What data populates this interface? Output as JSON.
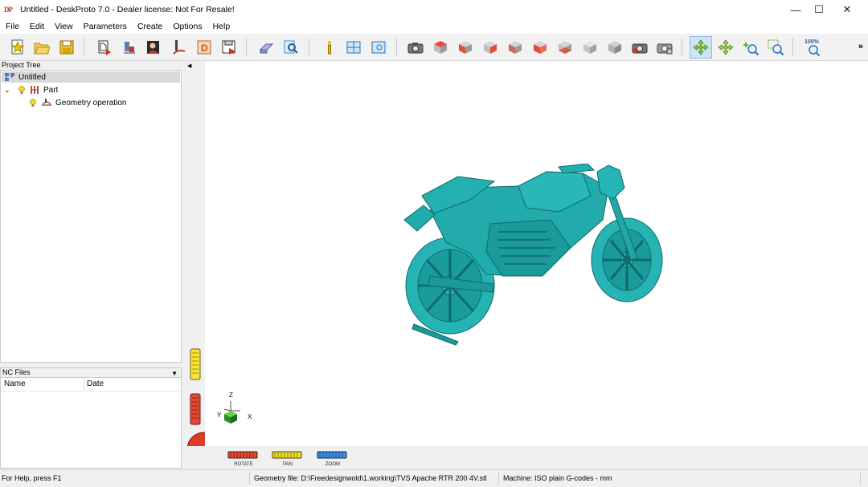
{
  "window": {
    "icon_text": "DP",
    "title": "Untitled - DeskProto 7.0 - Dealer license: Not For Resale!",
    "minimize": "—",
    "maximize": "☐",
    "close": "✕"
  },
  "menu": [
    "File",
    "Edit",
    "View",
    "Parameters",
    "Create",
    "Options",
    "Help"
  ],
  "toolbar": {
    "zoom_100_label": "100%",
    "more": "»"
  },
  "project_tree": {
    "header": "Project Tree",
    "root": "Untitled",
    "part": "Part",
    "geometry_operation": "Geometry operation"
  },
  "nc_files": {
    "header": "NC Files",
    "columns": [
      "Name",
      "Date"
    ]
  },
  "viewport": {
    "axis_z": "Z",
    "axis_y": "Y",
    "axis_x": "X",
    "model_color": "#1fa9a9"
  },
  "mouse_controls": {
    "rotate": "ROTATE",
    "pan": "PAN",
    "zoom": "ZOOM"
  },
  "status": {
    "help": "For Help, press F1",
    "geometry_file": "Geometry file: D:\\Freedesignwold\\1.working\\TVS Apache RTR 200 4V.stl",
    "machine": "Machine: ISO plain G-codes - mm"
  },
  "colors": {
    "accent": "#0078d7",
    "model": "#1fa9a9",
    "rotate": "#d13b2e",
    "pan": "#e8d21b",
    "zoom": "#2f7fd8"
  }
}
